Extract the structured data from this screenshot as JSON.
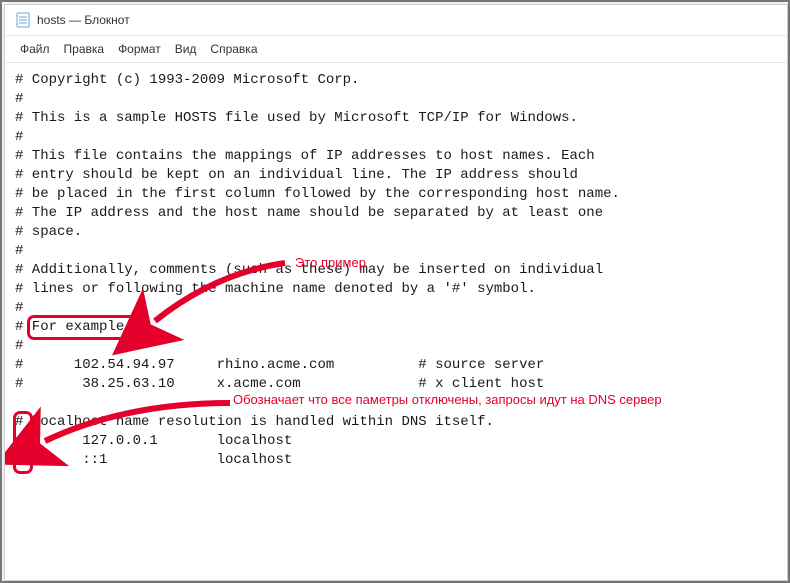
{
  "window": {
    "title": "hosts — Блокнот"
  },
  "menu": {
    "items": [
      {
        "label": "Файл"
      },
      {
        "label": "Правка"
      },
      {
        "label": "Формат"
      },
      {
        "label": "Вид"
      },
      {
        "label": "Справка"
      }
    ]
  },
  "content": {
    "lines": [
      "# Copyright (c) 1993-2009 Microsoft Corp.",
      "#",
      "# This is a sample HOSTS file used by Microsoft TCP/IP for Windows.",
      "#",
      "# This file contains the mappings of IP addresses to host names. Each",
      "# entry should be kept on an individual line. The IP address should",
      "# be placed in the first column followed by the corresponding host name.",
      "# The IP address and the host name should be separated by at least one",
      "# space.",
      "#",
      "# Additionally, comments (such as these) may be inserted on individual",
      "# lines or following the machine name denoted by a '#' symbol.",
      "#",
      "# For example:",
      "#",
      "#      102.54.94.97     rhino.acme.com          # source server",
      "#       38.25.63.10     x.acme.com              # x client host",
      "",
      "# localhost name resolution is handled within DNS itself.",
      "#       127.0.0.1       localhost",
      "#       ::1             localhost",
      ""
    ]
  },
  "annotations": {
    "arrow1_label": "Это пример",
    "arrow2_label": "Обозначает что все паметры отключены, запросы идут на DNS сервер"
  },
  "colors": {
    "accent_red": "#e4002b"
  }
}
